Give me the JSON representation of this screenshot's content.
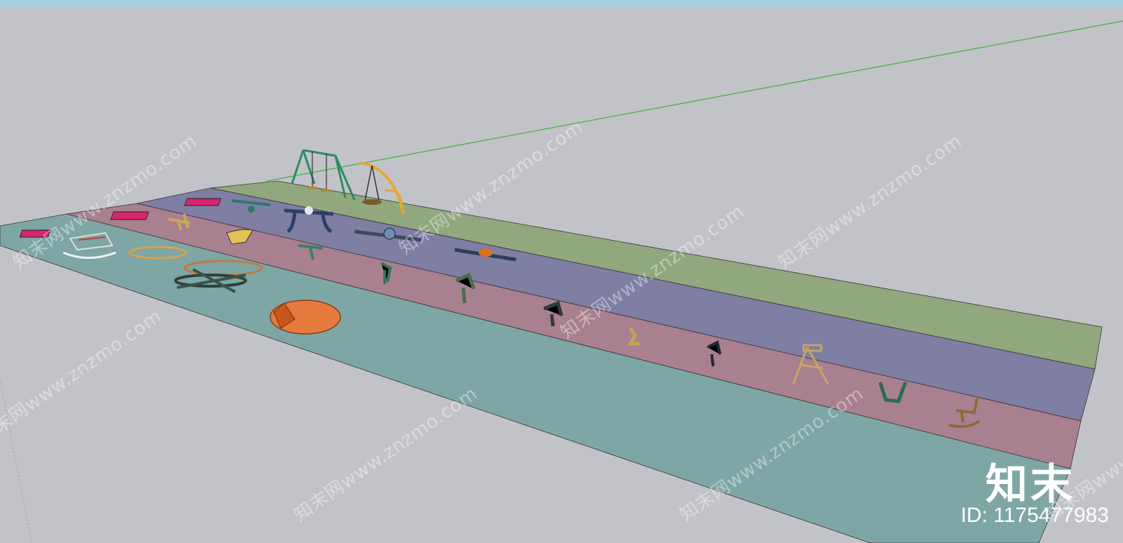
{
  "viewport": {
    "background": "#c2c3c8",
    "titlebar_color": "#a9cfe3",
    "axis_color": "#3fae3f"
  },
  "strips": [
    {
      "name": "teal-strip",
      "color": "#7ea6a5"
    },
    {
      "name": "pink-strip",
      "color": "#a9808f"
    },
    {
      "name": "purple-strip",
      "color": "#7f7fa3"
    },
    {
      "name": "green-strip",
      "color": "#91a87f"
    }
  ],
  "models": [
    "swing-set-model",
    "arc-swing-model",
    "seesaw-model",
    "spring-rider-model",
    "merry-go-round-model",
    "rocking-boat-model",
    "egg-shelter-model",
    "rocking-horse-model",
    "tower-chair-model",
    "sandbox-pad-model"
  ],
  "watermarks": [
    "知末网www.znzmo.com",
    "知末网www.znzmo.com",
    "知末网www.znzmo.com",
    "知末网www.znzmo.com",
    "知末网www.znzmo.com",
    "知末网www.znzmo.com",
    "知末网www.znzmo.com",
    "知末网www.znzmo.com"
  ],
  "brand": {
    "logo": "知末",
    "id_label": "ID: 1175477983"
  }
}
